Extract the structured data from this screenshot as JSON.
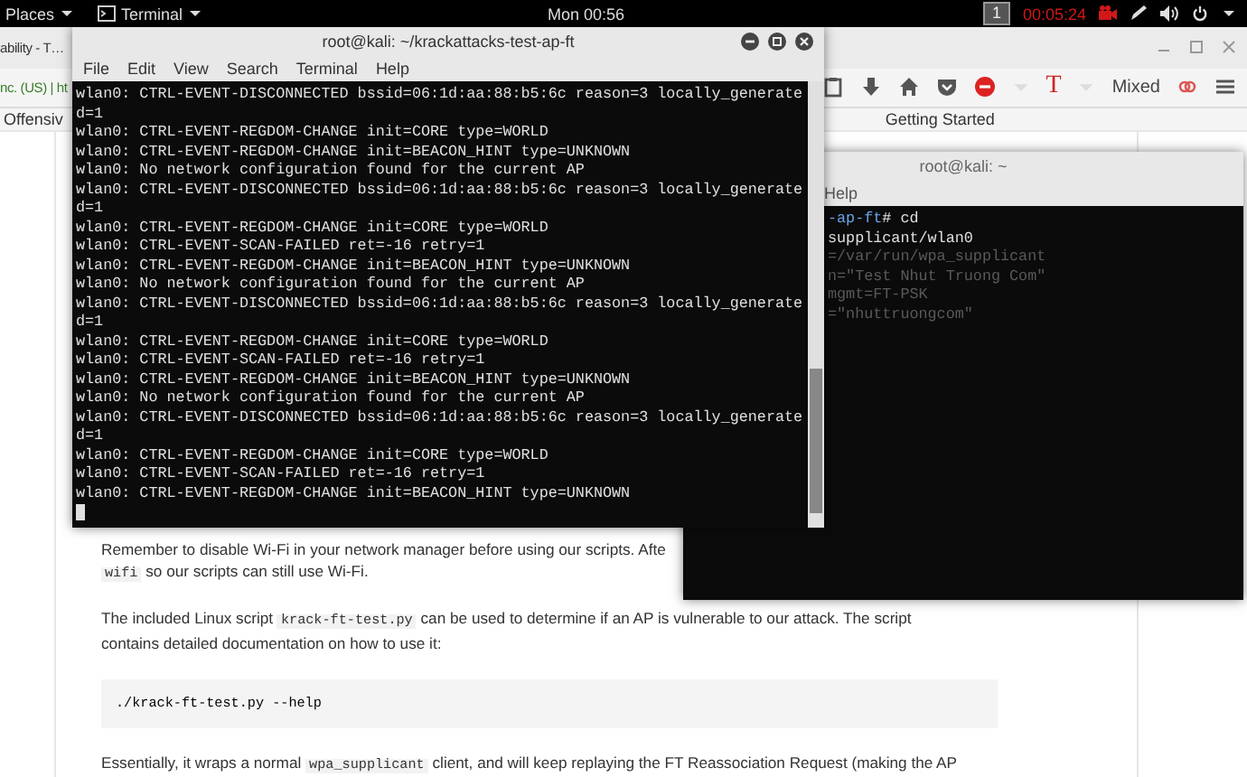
{
  "top_bar": {
    "places": "Places",
    "app": "Terminal",
    "clock": "Mon 00:56",
    "workspace": "1",
    "timer": "00:05:24"
  },
  "browser": {
    "tab_title": "ability - T…",
    "url": "nc. (US) | ht",
    "bookmarks": [
      {
        "label": "Offensiv"
      },
      {
        "label": "Getting Started"
      }
    ],
    "font_label": "T",
    "zoom_label": "Mixed",
    "paragraphs": [
      {
        "kind": "text",
        "lines": [
          [
            {
              "kind": "text",
              "text": "Remember to disable Wi-Fi in your network manager before using our scripts. Afte"
            }
          ],
          [
            {
              "kind": "code",
              "text": "wifi"
            },
            {
              "kind": "text",
              "text": " so our scripts can still use Wi-Fi."
            }
          ]
        ]
      },
      {
        "kind": "text",
        "lines": [
          [
            {
              "kind": "text",
              "text": "The included Linux script "
            },
            {
              "kind": "code",
              "text": "krack-ft-test.py"
            },
            {
              "kind": "text",
              "text": " can be used to determine if an AP is vulnerable to our attack. The script"
            }
          ],
          [
            {
              "kind": "text",
              "text": "contains detailed documentation on how to use it:"
            }
          ]
        ]
      },
      {
        "kind": "code_block",
        "lines": [
          [
            {
              "kind": "code",
              "text": "./krack-ft-test.py --help"
            }
          ]
        ]
      },
      {
        "kind": "text",
        "lines": [
          [
            {
              "kind": "text",
              "text": "Essentially, it wraps a normal "
            },
            {
              "kind": "code",
              "text": "wpa_supplicant"
            },
            {
              "kind": "text",
              "text": " client, and will keep replaying the FT Reassociation Request (making the AP"
            }
          ]
        ]
      }
    ]
  },
  "terminal": {
    "title": "root@kali: ~/krackattacks-test-ap-ft",
    "menu": [
      "File",
      "Edit",
      "View",
      "Search",
      "Terminal",
      "Help"
    ],
    "lines": [
      "wlan0: CTRL-EVENT-DISCONNECTED bssid=06:1d:aa:88:b5:6c reason=3 locally_generate",
      "d=1",
      "wlan0: CTRL-EVENT-REGDOM-CHANGE init=CORE type=WORLD",
      "wlan0: CTRL-EVENT-REGDOM-CHANGE init=BEACON_HINT type=UNKNOWN",
      "wlan0: No network configuration found for the current AP",
      "wlan0: CTRL-EVENT-DISCONNECTED bssid=06:1d:aa:88:b5:6c reason=3 locally_generate",
      "d=1",
      "wlan0: CTRL-EVENT-REGDOM-CHANGE init=CORE type=WORLD",
      "wlan0: CTRL-EVENT-SCAN-FAILED ret=-16 retry=1",
      "wlan0: CTRL-EVENT-REGDOM-CHANGE init=BEACON_HINT type=UNKNOWN",
      "wlan0: No network configuration found for the current AP",
      "wlan0: CTRL-EVENT-DISCONNECTED bssid=06:1d:aa:88:b5:6c reason=3 locally_generate",
      "d=1",
      "wlan0: CTRL-EVENT-REGDOM-CHANGE init=CORE type=WORLD",
      "wlan0: CTRL-EVENT-SCAN-FAILED ret=-16 retry=1",
      "wlan0: CTRL-EVENT-REGDOM-CHANGE init=BEACON_HINT type=UNKNOWN",
      "wlan0: No network configuration found for the current AP",
      "wlan0: CTRL-EVENT-DISCONNECTED bssid=06:1d:aa:88:b5:6c reason=3 locally_generate",
      "d=1",
      "wlan0: CTRL-EVENT-REGDOM-CHANGE init=CORE type=WORLD",
      "wlan0: CTRL-EVENT-SCAN-FAILED ret=-16 retry=1",
      "wlan0: CTRL-EVENT-REGDOM-CHANGE init=BEACON_HINT type=UNKNOWN"
    ]
  },
  "terminal_2": {
    "title": "root@kali: ~",
    "menu": [
      "Help"
    ],
    "lines": [
      {
        "kind": "prompt",
        "path": "-ap-ft",
        "text": "# cd"
      },
      {
        "kind": "plain",
        "text": "supplicant/wlan0"
      },
      {
        "kind": "faint",
        "text": "=/var/run/wpa_supplicant"
      },
      {
        "kind": "faint",
        "text": "n=\"Test Nhut Truong Com\""
      },
      {
        "kind": "faint",
        "text": "mgmt=FT-PSK"
      },
      {
        "kind": "faint",
        "text": "=\"nhuttruongcom\""
      }
    ]
  }
}
